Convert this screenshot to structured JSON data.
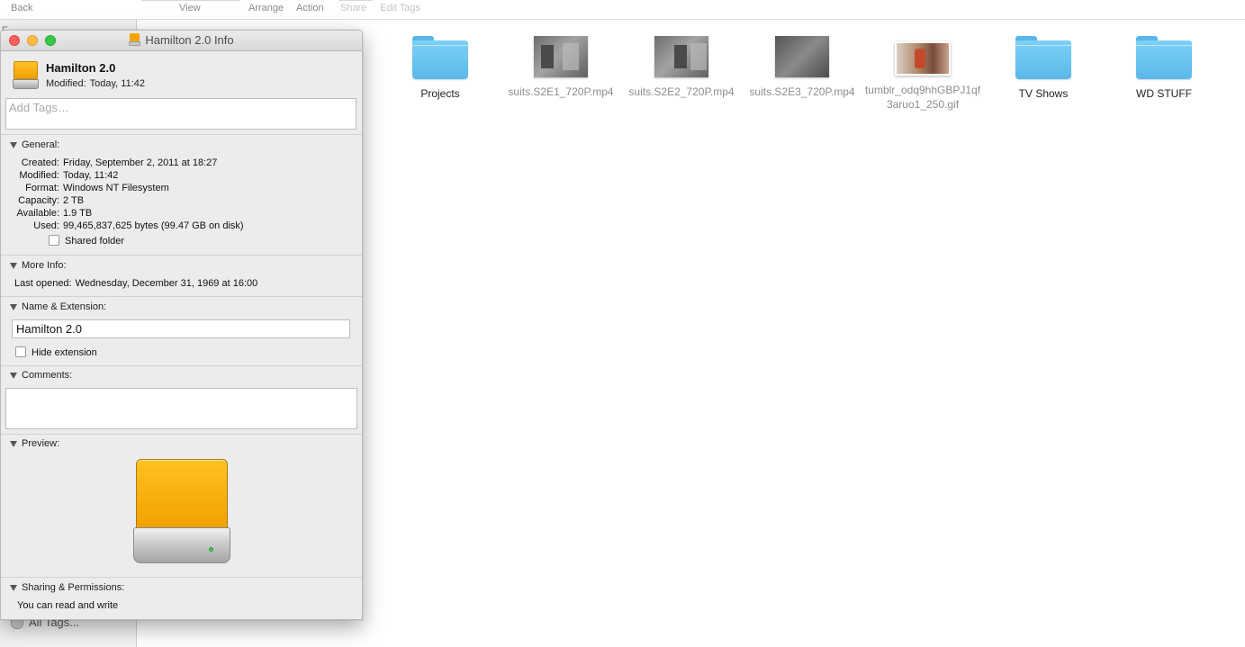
{
  "toolbar": {
    "back": "Back",
    "view": "View",
    "arrange": "Arrange",
    "action": "Action",
    "share": "Share",
    "edit_tags": "Edit Tags"
  },
  "sidebar": {
    "favorites_partial": "F",
    "all_tags": "All Tags..."
  },
  "files": [
    {
      "name": "Projects",
      "kind": "folder"
    },
    {
      "name": "suits.S2E1_720P.mp4",
      "kind": "video"
    },
    {
      "name": "suits.S2E2_720P.mp4",
      "kind": "video"
    },
    {
      "name": "suits.S2E3_720P.mp4",
      "kind": "video"
    },
    {
      "name": "tumblr_odq9hhGBPJ1qf3aruo1_250.gif",
      "kind": "gif"
    },
    {
      "name": "TV Shows",
      "kind": "folder"
    },
    {
      "name": "WD STUFF",
      "kind": "folder"
    }
  ],
  "info": {
    "window_title": "Hamilton 2.0 Info",
    "name": "Hamilton 2.0",
    "modified_label": "Modified:",
    "modified_value": "Today, 11:42",
    "tags_placeholder": "Add Tags…",
    "general": {
      "header": "General:",
      "created_label": "Created:",
      "created_value": "Friday, September 2, 2011 at 18:27",
      "modified_label": "Modified:",
      "modified_value": "Today, 11:42",
      "format_label": "Format:",
      "format_value": "Windows NT Filesystem",
      "capacity_label": "Capacity:",
      "capacity_value": "2 TB",
      "available_label": "Available:",
      "available_value": "1.9 TB",
      "used_label": "Used:",
      "used_value": "99,465,837,625 bytes (99.47 GB on disk)",
      "shared_folder": "Shared folder"
    },
    "more_info": {
      "header": "More Info:",
      "last_opened_label": "Last opened:",
      "last_opened_value": "Wednesday, December 31, 1969 at 16:00"
    },
    "name_ext": {
      "header": "Name & Extension:",
      "value": "Hamilton 2.0",
      "hide_extension": "Hide extension"
    },
    "comments": {
      "header": "Comments:",
      "value": ""
    },
    "preview": {
      "header": "Preview:"
    },
    "sharing": {
      "header": "Sharing & Permissions:",
      "text": "You can read and write"
    }
  },
  "colors": {
    "folder": "#6cc4f2",
    "drive_orange": "#f5a400",
    "close": "#fc605c",
    "minimize": "#fdbc40",
    "maximize": "#34c84a"
  }
}
